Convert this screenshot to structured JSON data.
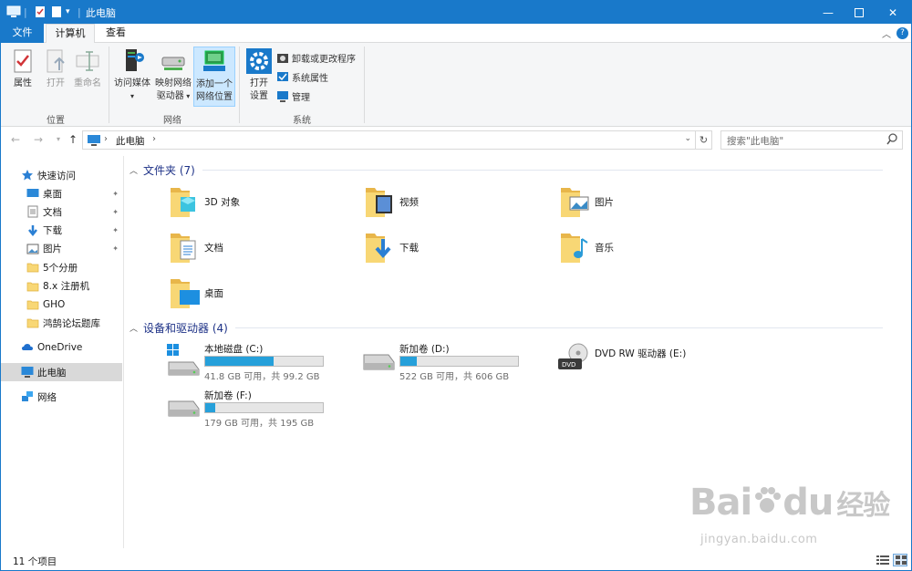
{
  "titlebar": {
    "title": "此电脑"
  },
  "ribbon_tabs": {
    "file": "文件",
    "computer": "计算机",
    "view": "查看"
  },
  "ribbon": {
    "location": {
      "properties": "属性",
      "open": "打开",
      "rename": "重命名",
      "label": "位置"
    },
    "network": {
      "access_media": "访问媒体",
      "map_drive_1": "映射网络",
      "map_drive_2": "驱动器",
      "add_location_1": "添加一个",
      "add_location_2": "网络位置",
      "label": "网络"
    },
    "system": {
      "open_settings_1": "打开",
      "open_settings_2": "设置",
      "uninstall": "卸载或更改程序",
      "sys_props": "系统属性",
      "manage": "管理",
      "label": "系统"
    }
  },
  "address": {
    "path": "此电脑",
    "search_placeholder": "搜索\"此电脑\""
  },
  "nav": {
    "quick_access": "快速访问",
    "items": [
      {
        "label": "桌面",
        "pinned": true
      },
      {
        "label": "文档",
        "pinned": true
      },
      {
        "label": "下载",
        "pinned": true
      },
      {
        "label": "图片",
        "pinned": true
      },
      {
        "label": "5个分册",
        "pinned": false
      },
      {
        "label": "8.x 注册机",
        "pinned": false
      },
      {
        "label": "GHO",
        "pinned": false
      },
      {
        "label": "鸿鹄论坛题库",
        "pinned": false
      }
    ],
    "onedrive": "OneDrive",
    "thispc": "此电脑",
    "network": "网络"
  },
  "folders": {
    "header": "文件夹 (7)",
    "items": [
      "3D 对象",
      "视频",
      "图片",
      "文档",
      "下载",
      "音乐",
      "桌面"
    ]
  },
  "drives": {
    "header": "设备和驱动器 (4)",
    "items": [
      {
        "name": "本地磁盘 (C:)",
        "info": "41.8 GB 可用，共 99.2 GB",
        "used": 0.579
      },
      {
        "name": "新加卷 (D:)",
        "info": "522 GB 可用，共 606 GB",
        "used": 0.139
      },
      {
        "name": "DVD RW 驱动器 (E:)",
        "info": "",
        "used": null
      },
      {
        "name": "新加卷 (F:)",
        "info": "179 GB 可用，共 195 GB",
        "used": 0.082
      }
    ]
  },
  "status": {
    "count": "11 个项目"
  },
  "watermark": {
    "brand": "Bai",
    "brand2": "du",
    "cn": "经验",
    "url": "jingyan.baidu.com"
  },
  "colors": {
    "accent": "#1979ca",
    "drive_fill": "#26a0da",
    "folder": "#f8d775",
    "header_text": "#1e3287"
  }
}
